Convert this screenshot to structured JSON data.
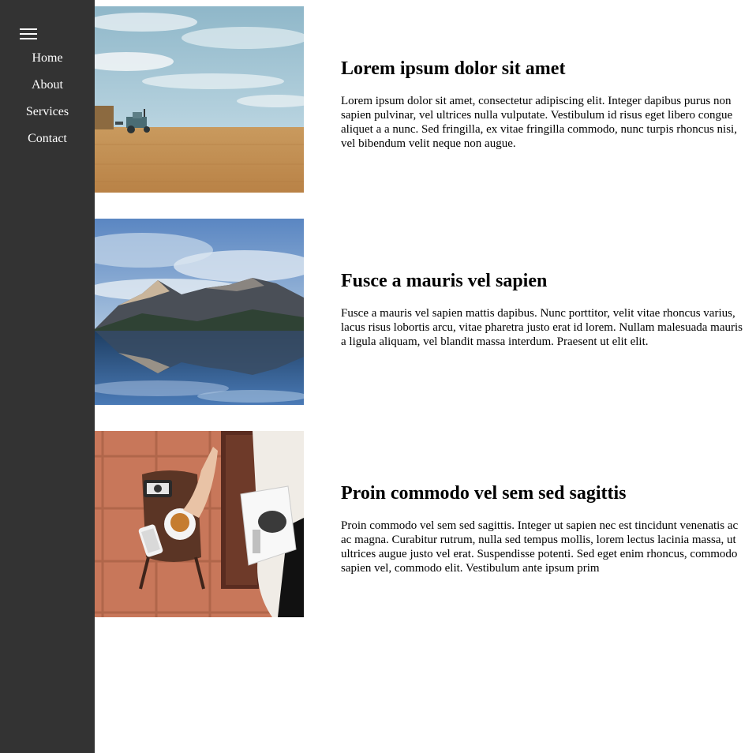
{
  "nav": {
    "menu_icon": "hamburger-menu-icon",
    "items": [
      {
        "label": "Home"
      },
      {
        "label": "About"
      },
      {
        "label": "Services"
      },
      {
        "label": "Contact"
      }
    ]
  },
  "articles": [
    {
      "image": "tractor-field-photo",
      "title": "Lorem ipsum dolor sit amet",
      "body": "Lorem ipsum dolor sit amet, consectetur adipiscing elit. Integer dapibus purus non sapien pulvinar, vel ultrices nulla vulputate. Vestibulum id risus eget libero congue aliquet a a nunc. Sed fringilla, ex vitae fringilla commodo, nunc turpis rhoncus nisi, vel bibendum velit neque non augue."
    },
    {
      "image": "mountain-lake-photo",
      "title": "Fusce a mauris vel sapien",
      "body": "Fusce a mauris vel sapien mattis dapibus. Nunc porttitor, velit vitae rhoncus varius, lacus risus lobortis arcu, vitae pharetra justo erat id lorem. Nullam malesuada mauris a ligula aliquam, vel blandit massa interdum. Praesent ut elit elit."
    },
    {
      "image": "coffee-table-photo",
      "title": "Proin commodo vel sem sed sagittis",
      "body": "Proin commodo vel sem sed sagittis. Integer ut sapien nec est tincidunt venenatis ac ac magna. Curabitur rutrum, nulla sed tempus mollis, lorem lectus lacinia massa, ut ultrices augue justo vel erat. Suspendisse potenti. Sed eget enim rhoncus, commodo sapien vel, commodo elit. Vestibulum ante ipsum prim"
    }
  ],
  "colors": {
    "sidebar_bg": "#333333",
    "nav_text": "#ffffff",
    "page_bg": "#ffffff"
  }
}
